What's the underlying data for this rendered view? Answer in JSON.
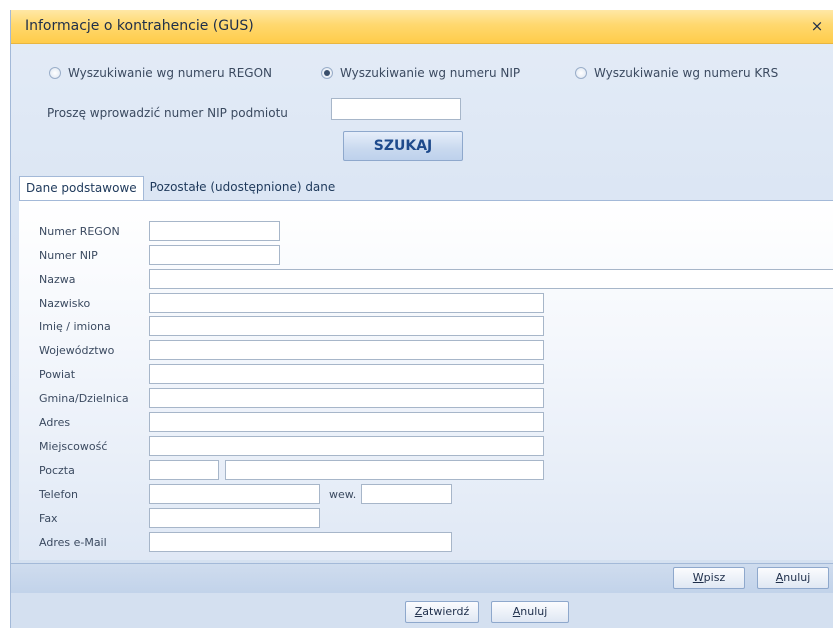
{
  "window": {
    "title": "Informacje o kontrahencie (GUS)",
    "close_icon": "×"
  },
  "search_mode": {
    "options": [
      {
        "label": "Wyszukiwanie wg numeru REGON",
        "checked": false
      },
      {
        "label": "Wyszukiwanie wg numeru NIP",
        "checked": true
      },
      {
        "label": "Wyszukiwanie wg numeru KRS",
        "checked": false
      }
    ],
    "prompt_label": "Proszę wprowadzić numer NIP podmiotu",
    "nip_value": "",
    "search_button": "SZUKAJ"
  },
  "tabs": [
    {
      "label": "Dane podstawowe",
      "active": true
    },
    {
      "label": "Pozostałe (udostępnione) dane",
      "active": false
    }
  ],
  "fields": {
    "regon": "Numer REGON",
    "nip": "Numer NIP",
    "nazwa": "Nazwa",
    "nazwisko": "Nazwisko",
    "imie": "Imię / imiona",
    "wojewodztwo": "Województwo",
    "powiat": "Powiat",
    "gmina": "Gmina/Dzielnica",
    "adres": "Adres",
    "miejscowosc": "Miejscowość",
    "poczta": "Poczta",
    "telefon": "Telefon",
    "wew": "wew.",
    "fax": "Fax",
    "email": "Adres e-Mail"
  },
  "panel_buttons": {
    "wpisz": {
      "mnemonic": "W",
      "rest": "pisz"
    },
    "anuluj": {
      "mnemonic": "A",
      "rest": "nuluj"
    }
  },
  "dialog_buttons": {
    "zatwierdz": {
      "mnemonic": "Z",
      "rest": "atwierdź"
    },
    "anuluj": {
      "mnemonic": "A",
      "rest": "nuluj"
    }
  }
}
